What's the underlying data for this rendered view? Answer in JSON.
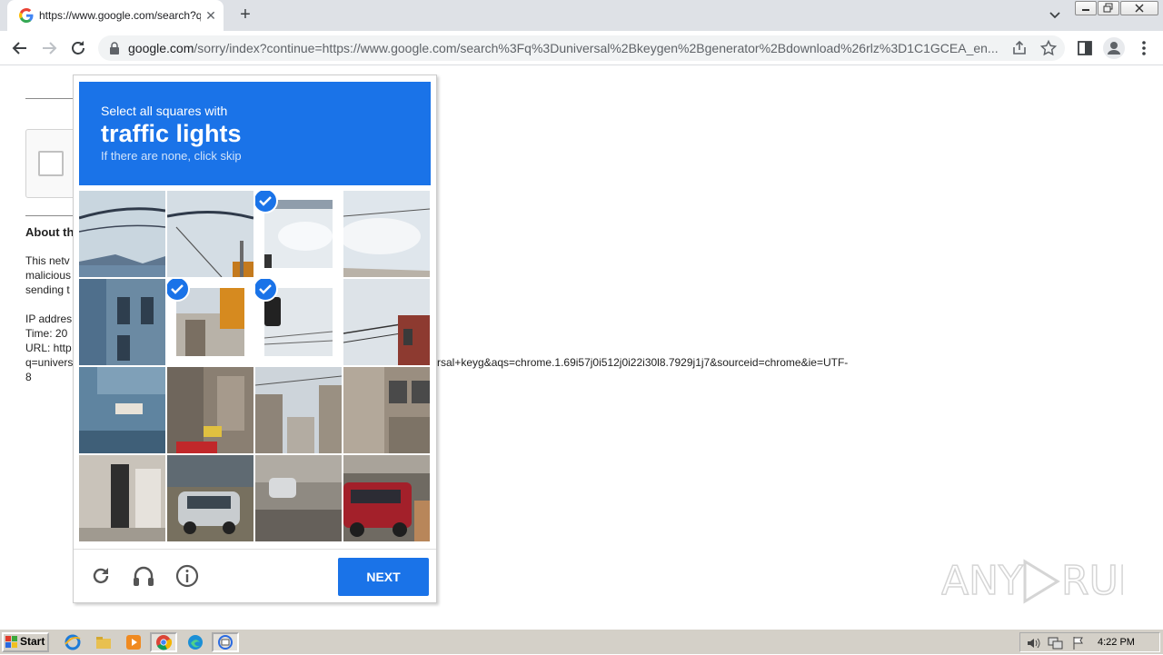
{
  "browser": {
    "tab_title": "https://www.google.com/search?q=universal+keygen+generator+download",
    "tab_close": "✕",
    "new_tab": "+",
    "url_host": "google.com",
    "url_path": "/sorry/index?continue=https://www.google.com/search%3Fq%3Duniversal%2Bkeygen%2Bgenerator%2Bdownload%26rlz%3D1C1GCEA_en..."
  },
  "page": {
    "about_heading": "About th",
    "para_lines": [
      "This netv",
      "malicious",
      "sending t"
    ],
    "info_lines": [
      "IP addres",
      "Time: 20",
      "URL: http",
      "q=univers"
    ],
    "url_tail": "rsal+keyg&aqs=chrome.1.69i57j0i512j0i22i30l8.7929j1j7&sourceid=chrome&ie=UTF-",
    "url_tail_end": "8"
  },
  "challenge": {
    "instruction": "Select all squares with",
    "target": "traffic lights",
    "hint": "If there are none, click skip",
    "next_label": "NEXT",
    "selected_tiles": [
      2,
      5,
      6
    ]
  },
  "watermark": {
    "text": "ANY RUN"
  },
  "taskbar": {
    "start_label": "Start",
    "clock": "4:22 PM"
  },
  "colors": {
    "accent": "#1a73e8",
    "page_bg": "#ffffff",
    "taskbar": "#d4d0c8"
  }
}
